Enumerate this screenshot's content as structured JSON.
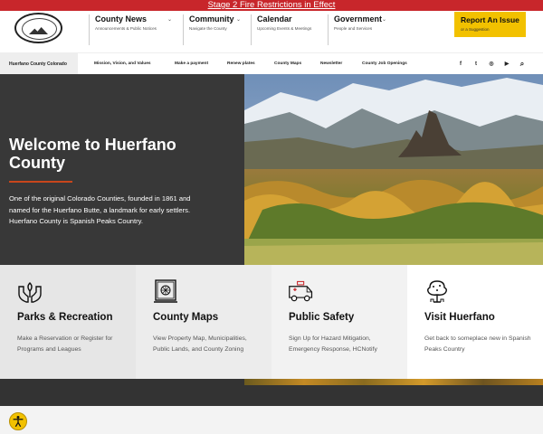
{
  "alert": {
    "text": "Stage 2 Fire Restrictions in Effect"
  },
  "nav": [
    {
      "title": "County News",
      "sub": "Announcements & Public Notices"
    },
    {
      "title": "Community",
      "sub": "Navigate the County"
    },
    {
      "title": "Calendar",
      "sub": "Upcoming Events & Meetings"
    },
    {
      "title": "Government",
      "sub": "People and Services"
    }
  ],
  "report": {
    "title": "Report An Issue",
    "sub": "or a Suggestion"
  },
  "subnav": {
    "home": "Huerfano County Colorado",
    "links": [
      "Mission, Vision, and Values",
      "Make a payment",
      "Renew plates",
      "County Maps",
      "Newsletter",
      "County Job Openings"
    ]
  },
  "social": [
    {
      "icon": "facebook-icon",
      "glyph": "f"
    },
    {
      "icon": "twitter-icon",
      "glyph": "t"
    },
    {
      "icon": "instagram-icon",
      "glyph": "◎"
    },
    {
      "icon": "youtube-icon",
      "glyph": "▶"
    },
    {
      "icon": "search-icon",
      "glyph": "⌕"
    }
  ],
  "hero": {
    "title": "Welcome to Huerfano County",
    "body": "One of the original Colorado Counties, founded in 1861 and named for the Huerfano Butte, a landmark for early settlers. Huerfano County is Spanish Peaks Country."
  },
  "cards": [
    {
      "title": "Parks & Recreation",
      "desc": "Make a Reservation or Register for Programs and Leagues",
      "icon": "hands-plant-icon",
      "bg": "#e6e6e6"
    },
    {
      "title": "County Maps",
      "desc": "View Property Map, Municipalities, Public Lands, and County Zoning",
      "icon": "map-icon",
      "bg": "#ececec"
    },
    {
      "title": "Public Safety",
      "desc": "Sign Up for Hazard Mitigation, Emergency Response, HCNotify",
      "icon": "ambulance-icon",
      "bg": "#f2f2f2"
    },
    {
      "title": "Visit Huerfano",
      "desc": "Get back to someplace new in Spanish Peaks Country",
      "icon": "tree-icon",
      "bg": "#ffffff"
    }
  ],
  "colors": {
    "alert": "#c8262b",
    "accent": "#f2c100",
    "hero": "#383838",
    "rule": "#c8461b"
  }
}
